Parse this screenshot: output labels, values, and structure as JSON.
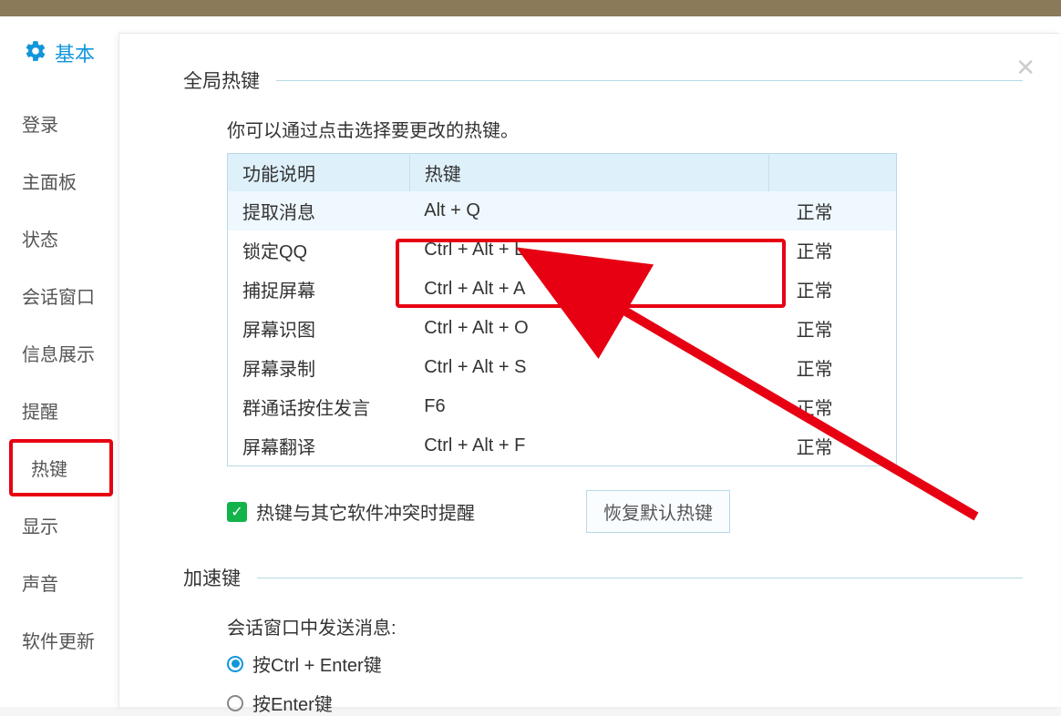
{
  "sidebar": {
    "title": "基本",
    "items": [
      {
        "label": "登录"
      },
      {
        "label": "主面板"
      },
      {
        "label": "状态"
      },
      {
        "label": "会话窗口"
      },
      {
        "label": "信息展示"
      },
      {
        "label": "提醒"
      },
      {
        "label": "热键",
        "highlighted": true
      },
      {
        "label": "显示"
      },
      {
        "label": "声音"
      },
      {
        "label": "软件更新"
      }
    ]
  },
  "hotkeys": {
    "section_title": "全局热键",
    "help_text": "你可以通过点击选择要更改的热键。",
    "columns": {
      "func": "功能说明",
      "key": "热键",
      "status": ""
    },
    "rows": [
      {
        "func": "提取消息",
        "key": "Alt + Q",
        "status": "正常",
        "selected": true
      },
      {
        "func": "锁定QQ",
        "key": "Ctrl + Alt + L",
        "status": "正常"
      },
      {
        "func": "捕捉屏幕",
        "key": "Ctrl + Alt + A",
        "status": "正常"
      },
      {
        "func": "屏幕识图",
        "key": "Ctrl + Alt + O",
        "status": "正常"
      },
      {
        "func": "屏幕录制",
        "key": "Ctrl + Alt + S",
        "status": "正常"
      },
      {
        "func": "群通话按住发言",
        "key": "F6",
        "status": "正常"
      },
      {
        "func": "屏幕翻译",
        "key": "Ctrl + Alt + F",
        "status": "正常"
      }
    ],
    "conflict_label": "热键与其它软件冲突时提醒",
    "restore_label": "恢复默认热键"
  },
  "accel": {
    "section_title": "加速键",
    "sub_label": "会话窗口中发送消息:",
    "options": [
      {
        "label": "按Ctrl + Enter键",
        "checked": true
      },
      {
        "label": "按Enter键",
        "checked": false
      }
    ]
  }
}
